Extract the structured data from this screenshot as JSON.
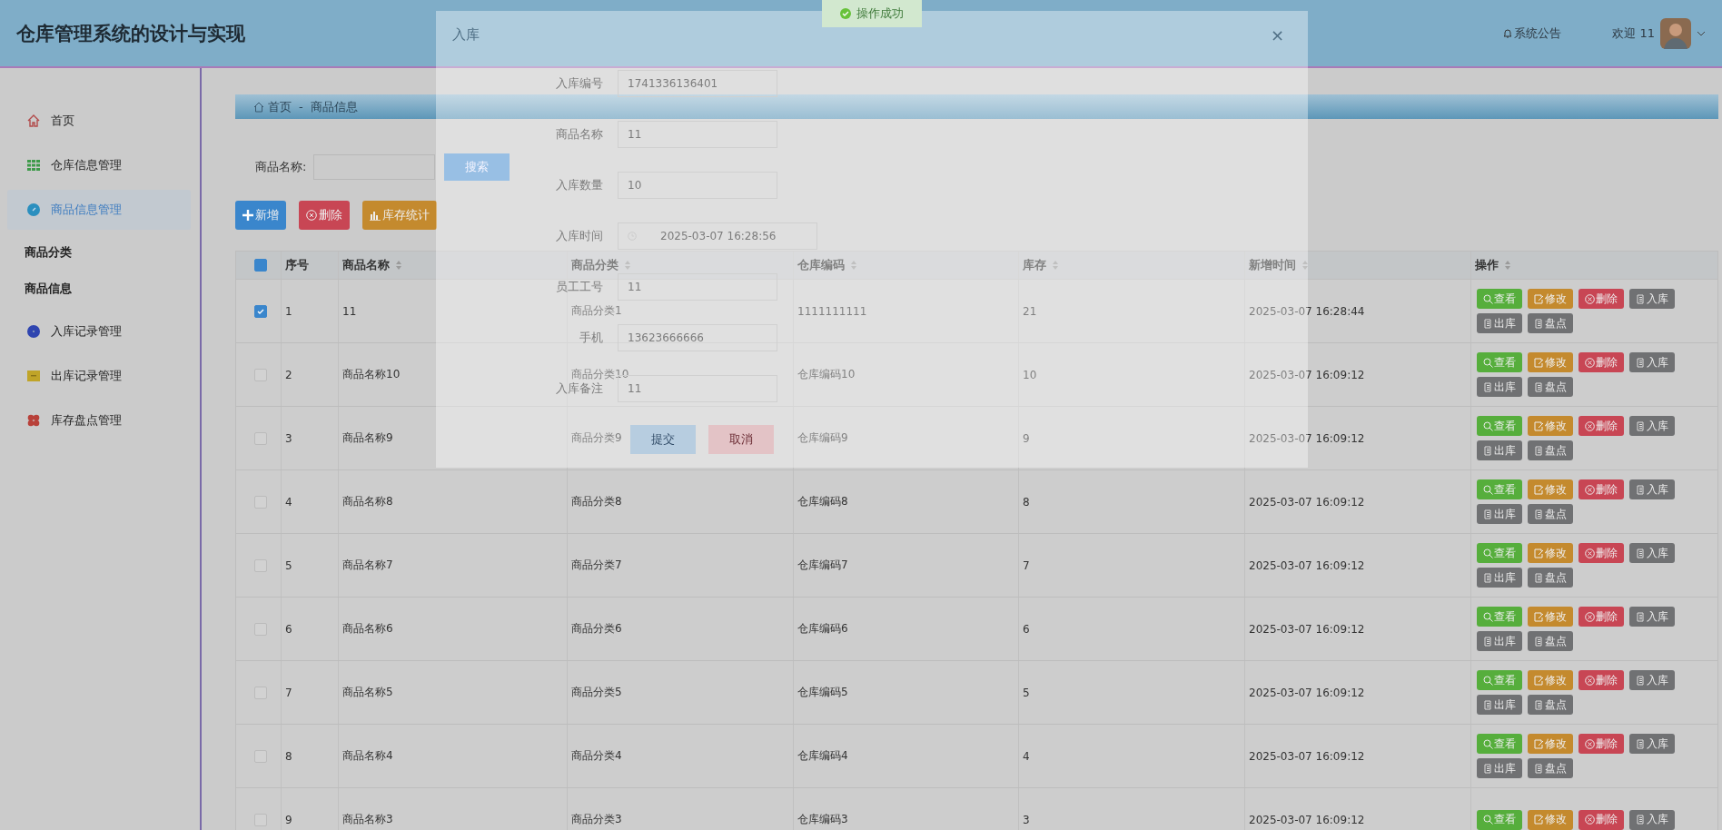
{
  "header": {
    "title": "仓库管理系统的设计与实现",
    "notice": "系统公告",
    "welcome": "欢迎 11"
  },
  "sidebar": {
    "items": [
      {
        "label": "首页",
        "kind": "menu",
        "selected": false
      },
      {
        "label": "仓库信息管理",
        "kind": "menu",
        "selected": false
      },
      {
        "label": "商品信息管理",
        "kind": "menu",
        "selected": true
      },
      {
        "label": "商品分类",
        "kind": "sub",
        "selected": false
      },
      {
        "label": "商品信息",
        "kind": "sub",
        "selected": false
      },
      {
        "label": "入库记录管理",
        "kind": "menu",
        "selected": false
      },
      {
        "label": "出库记录管理",
        "kind": "menu",
        "selected": false
      },
      {
        "label": "库存盘点管理",
        "kind": "menu",
        "selected": false
      }
    ]
  },
  "breadcrumb": [
    "首页",
    "-",
    "商品信息"
  ],
  "search": {
    "label": "商品名称:",
    "button": "搜索"
  },
  "toolbar": [
    "新增",
    "删除",
    "库存统计"
  ],
  "table": {
    "select_all_partial": true,
    "columns": [
      {
        "label": "序号",
        "sortable": false
      },
      {
        "label": "商品名称",
        "sortable": true
      },
      {
        "label": "商品分类",
        "sortable": true
      },
      {
        "label": "仓库编码",
        "sortable": true
      },
      {
        "label": "库存",
        "sortable": true
      },
      {
        "label": "新增时间",
        "sortable": true
      },
      {
        "label": "操作",
        "sortable": true
      }
    ],
    "rows": [
      {
        "checked": true,
        "cells": [
          "1",
          "11",
          "商品分类1",
          "1111111111",
          "21",
          "2025-03-07 16:28:44"
        ],
        "actions": [
          "查看",
          "修改",
          "删除",
          "入库",
          "出库",
          "盘点"
        ]
      },
      {
        "checked": false,
        "cells": [
          "2",
          "商品名称10",
          "商品分类10",
          "仓库编码10",
          "10",
          "2025-03-07 16:09:12"
        ],
        "actions": [
          "查看",
          "修改",
          "删除",
          "入库",
          "出库",
          "盘点"
        ]
      },
      {
        "checked": false,
        "cells": [
          "3",
          "商品名称9",
          "商品分类9",
          "仓库编码9",
          "9",
          "2025-03-07 16:09:12"
        ],
        "actions": [
          "查看",
          "修改",
          "删除",
          "入库",
          "出库",
          "盘点"
        ]
      },
      {
        "checked": false,
        "cells": [
          "4",
          "商品名称8",
          "商品分类8",
          "仓库编码8",
          "8",
          "2025-03-07 16:09:12"
        ],
        "actions": [
          "查看",
          "修改",
          "删除",
          "入库",
          "出库",
          "盘点"
        ]
      },
      {
        "checked": false,
        "cells": [
          "5",
          "商品名称7",
          "商品分类7",
          "仓库编码7",
          "7",
          "2025-03-07 16:09:12"
        ],
        "actions": [
          "查看",
          "修改",
          "删除",
          "入库",
          "出库",
          "盘点"
        ]
      },
      {
        "checked": false,
        "cells": [
          "6",
          "商品名称6",
          "商品分类6",
          "仓库编码6",
          "6",
          "2025-03-07 16:09:12"
        ],
        "actions": [
          "查看",
          "修改",
          "删除",
          "入库",
          "出库",
          "盘点"
        ]
      },
      {
        "checked": false,
        "cells": [
          "7",
          "商品名称5",
          "商品分类5",
          "仓库编码5",
          "5",
          "2025-03-07 16:09:12"
        ],
        "actions": [
          "查看",
          "修改",
          "删除",
          "入库",
          "出库",
          "盘点"
        ]
      },
      {
        "checked": false,
        "cells": [
          "8",
          "商品名称4",
          "商品分类4",
          "仓库编码4",
          "4",
          "2025-03-07 16:09:12"
        ],
        "actions": [
          "查看",
          "修改",
          "删除",
          "入库",
          "出库",
          "盘点"
        ]
      },
      {
        "checked": false,
        "cells": [
          "9",
          "商品名称3",
          "商品分类3",
          "仓库编码3",
          "3",
          "2025-03-07 16:09:12"
        ],
        "actions": [
          "查看",
          "修改",
          "删除",
          "入库"
        ]
      }
    ]
  },
  "dialog": {
    "title": "入库",
    "close": "×",
    "fields": [
      {
        "label": "入库编号",
        "value": "1741336136401",
        "kind": "text"
      },
      {
        "label": "商品名称",
        "value": "11",
        "kind": "text"
      },
      {
        "label": "入库数量",
        "value": "10",
        "kind": "text"
      },
      {
        "label": "入库时间",
        "value": "2025-03-07 16:28:56",
        "kind": "datetime"
      },
      {
        "label": "员工工号",
        "value": "11",
        "kind": "text"
      },
      {
        "label": "手机",
        "value": "13623666666",
        "kind": "text"
      },
      {
        "label": "入库备注",
        "value": "11",
        "kind": "text"
      }
    ],
    "buttons": [
      "提交",
      "取消"
    ]
  },
  "toast": {
    "message": "操作成功"
  }
}
